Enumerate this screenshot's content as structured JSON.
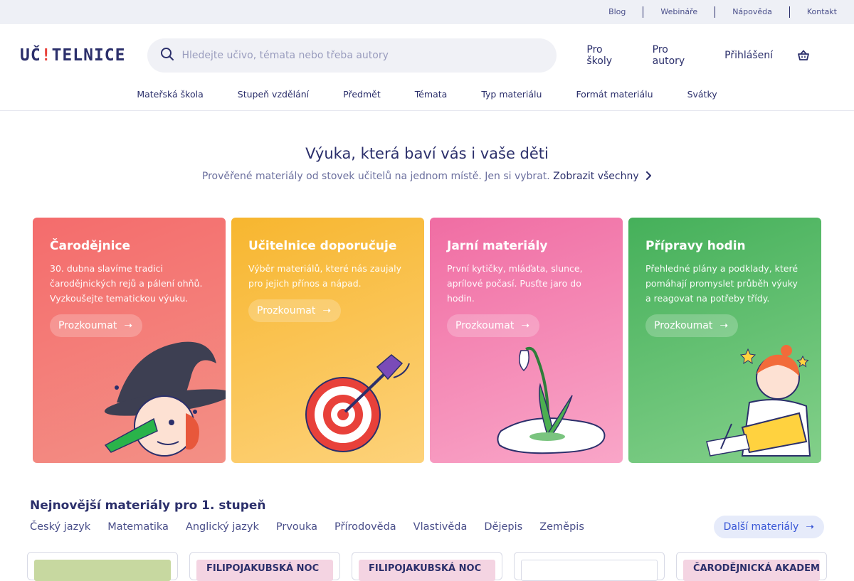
{
  "topbar": {
    "links": [
      "Blog",
      "Webináře",
      "Nápověda",
      "Kontakt"
    ]
  },
  "header": {
    "logo_pre": "UČ",
    "logo_mark": "!",
    "logo_post": "TELNICE",
    "search_placeholder": "Hledejte učivo, témata nebo třeba autory",
    "nav": [
      "Pro školy",
      "Pro autory",
      "Přihlášení"
    ]
  },
  "catnav": {
    "items": [
      "Mateřská škola",
      "Stupeň vzdělání",
      "Předmět",
      "Témata",
      "Typ materiálu",
      "Formát materiálu",
      "Svátky"
    ]
  },
  "hero": {
    "title": "Výuka, která baví vás i vaše děti",
    "subtitle": "Prověřené materiály od stovek učitelů na jednom místě. Jen si vybrat.",
    "link": "Zobrazit všechny"
  },
  "cards": [
    {
      "title": "Čarodějnice",
      "text": "30. dubna slavíme tradici čarodějnických rejů a pálení ohňů. Vyzkoušejte tematickou výuku.",
      "button": "Prozkoumat"
    },
    {
      "title": "Učitelnice doporučuje",
      "text": "Výběr materiálů, které nás zaujaly pro jejich přínos a nápad.",
      "button": "Prozkoumat"
    },
    {
      "title": "Jarní materiály",
      "text": "První kytičky, mláďata, slunce, aprílové počasí. Pusťte jaro do hodin.",
      "button": "Prozkoumat"
    },
    {
      "title": "Přípravy hodin",
      "text": "Přehledné plány a podklady, které pomáhají promyslet průběh výuky a reagovat na potřeby třídy.",
      "button": "Prozkoumat"
    }
  ],
  "newest": {
    "title": "Nejnovější materiály pro 1. stupeň",
    "subjects": [
      "Český jazyk",
      "Matematika",
      "Anglický jazyk",
      "Prvouka",
      "Přírodověda",
      "Vlastivěda",
      "Dějepis",
      "Zeměpis"
    ],
    "more": "Další materiály",
    "thumbs": [
      "",
      "FILIPOJAKUBSKÁ NOC",
      "FILIPOJAKUBSKÁ NOC",
      "",
      "ČARODĚJNICKÁ AKADEMIE"
    ]
  },
  "colors": {
    "primary_text": "#2b2f6b",
    "accent_red": "#e8413a",
    "card_red": "#f46c6c",
    "card_yellow": "#f7b62f",
    "card_pink": "#f06da3",
    "card_green": "#45b05a",
    "more_button": "#3856d6"
  }
}
